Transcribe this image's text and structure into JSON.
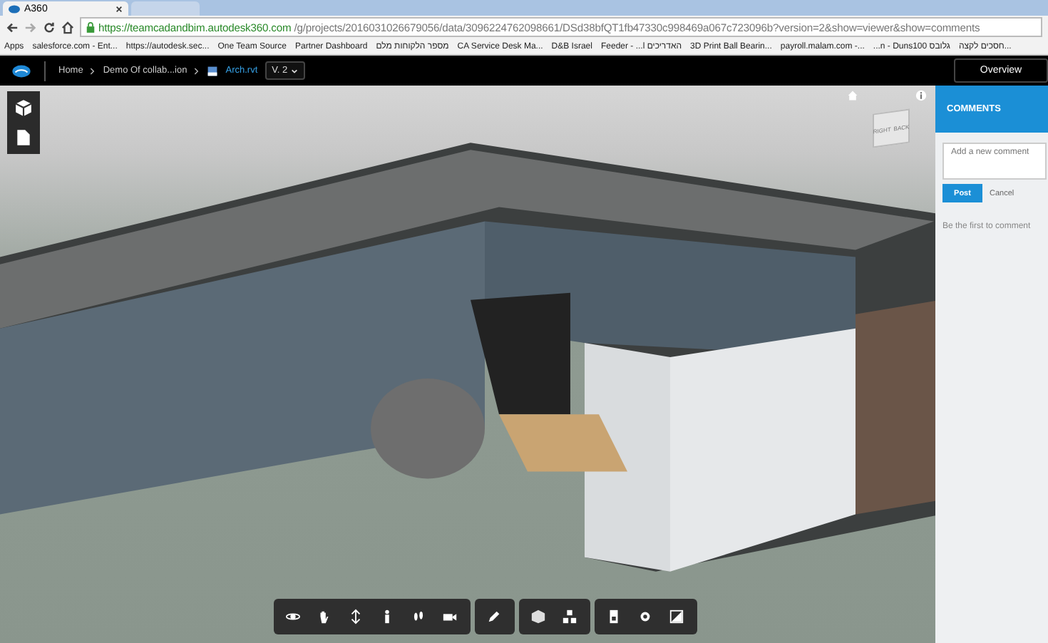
{
  "browser": {
    "tab_title": "A360",
    "url_host": "https://teamcadandbim.autodesk360.com",
    "url_path": "/g/projects/2016031026679056/data/3096224762098661/DSd38bfQT1fb47330c998469a067c723096b?version=2&show=viewer&show=comments",
    "bookmarks": [
      "Apps",
      "salesforce.com - Ent...",
      "https://autodesk.sec...",
      "One Team Source",
      "Partner Dashboard",
      "מספר הלקוחות מלם",
      "CA Service Desk Ma...",
      "D&B Israel",
      "Feeder - ...l האדריכים",
      "3D Print Ball Bearin...",
      "payroll.malam.com -...",
      "...n - Duns100 גלובס",
      "חסכים לקצה..."
    ]
  },
  "app_bar": {
    "breadcrumbs": [
      "Home",
      "Demo Of collab...ion"
    ],
    "file": "Arch.rvt",
    "version": "V. 2",
    "overview": "Overview"
  },
  "viewcube": {
    "faces": [
      "RIGHT",
      "BACK"
    ]
  },
  "comments": {
    "title": "COMMENTS",
    "placeholder": "Add a new comment",
    "post": "Post",
    "cancel": "Cancel",
    "empty": "Be the first to comment"
  }
}
